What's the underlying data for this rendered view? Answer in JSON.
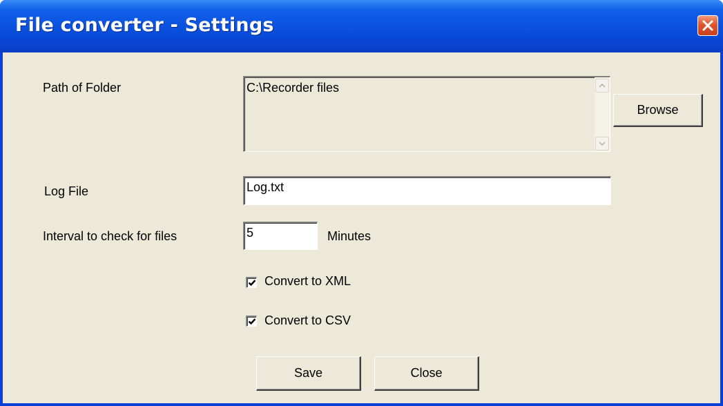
{
  "window": {
    "title": "File converter - Settings",
    "close_icon": "close-icon"
  },
  "colors": {
    "titlebar_blue": "#0a50de",
    "client_bg": "#ece9d8",
    "close_red": "#e0552c"
  },
  "form": {
    "path_label": "Path of Folder",
    "path_value": "C:\\Recorder files",
    "browse_label": "Browse",
    "log_label": "Log File",
    "log_value": "Log.txt",
    "interval_label": "Interval to check for files",
    "interval_value": "5",
    "interval_unit": "Minutes",
    "xml_label": "Convert to XML",
    "xml_checked": true,
    "csv_label": "Convert to CSV",
    "csv_checked": true,
    "save_label": "Save",
    "close_label": "Close"
  }
}
